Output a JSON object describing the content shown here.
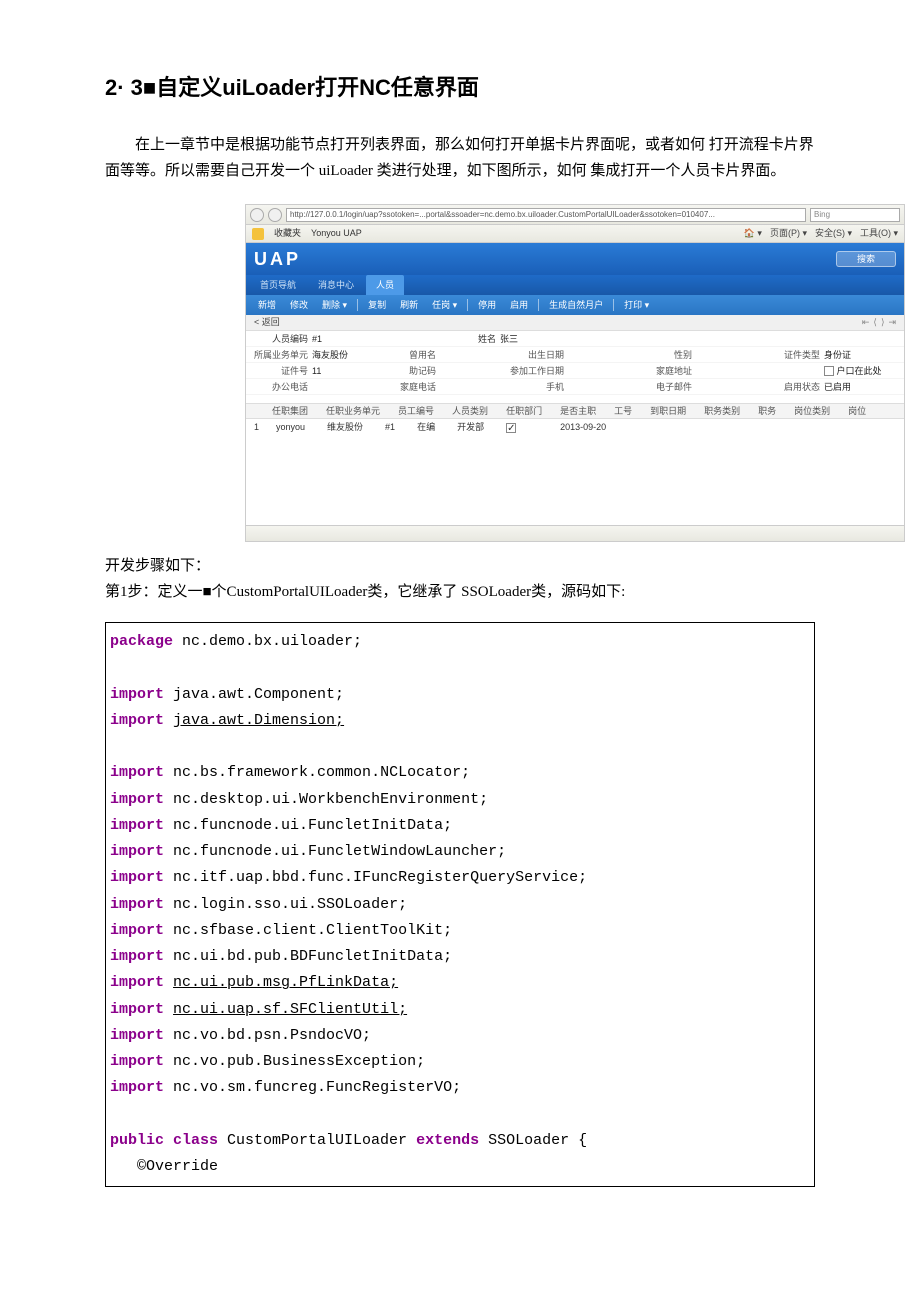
{
  "heading": "2· 3■自定义uiLoader打开NC任意界面",
  "intro": "在上一章节中是根据功能节点打开列表界面，那么如何打开单据卡片界面呢，或者如何 打开流程卡片界面等等。所以需要自己开发一个 uiLoader 类进行处理，如下图所示，如何 集成打开一个人员卡片界面。",
  "steps_intro": "开发步骤如下：",
  "step1": "第1步：定义一■个CustomPortalUILoader类，它继承了 SSOLoader类，源码如下:",
  "screenshot": {
    "browser": {
      "url": "http://127.0.0.1/login/uap?ssotoken=...portal&ssoader=nc.demo.bx.uiloader.CustomPortalUILoader&ssotoken=010407...",
      "search_placeholder": "Bing",
      "fav_label": "收藏夹",
      "fav_item": "Yonyou UAP",
      "fav_menu": [
        "页面(P) ▾",
        "安全(S) ▾",
        "工具(O) ▾"
      ]
    },
    "uap": {
      "logo": "UAP",
      "search_btn": "搜索",
      "tabs": [
        "首页导航",
        "消息中心",
        "人员"
      ],
      "toolbar": [
        "新增",
        "修改",
        "删除 ▾",
        "复制",
        "刷新",
        "任岗 ▾",
        "停用",
        "启用",
        "生成自然月户",
        "打印 ▾"
      ]
    },
    "back_label": "< 返回",
    "pager": [
      "⇤",
      "⟨",
      "⟩",
      "⇥"
    ],
    "form": {
      "row0": {
        "lbl1": "人员编码",
        "val1": "#1",
        "lbl2": "姓名",
        "val2": "张三"
      },
      "row1": {
        "lbl1": "所属业务单元",
        "val1": "海友股份",
        "lbl2": "曾用名",
        "lbl3": "出生日期",
        "lbl4": "性别",
        "lbl5": "证件类型",
        "val5": "身份证"
      },
      "row2": {
        "lbl1": "证件号",
        "val1": "11",
        "lbl2": "助记码",
        "lbl3": "参加工作日期",
        "lbl4": "家庭地址",
        "lbl6": "户口在此处"
      },
      "row3": {
        "lbl1": "办公电话",
        "lbl2": "家庭电话",
        "lbl3": "手机",
        "lbl4": "电子邮件",
        "lbl5": "启用状态",
        "val5": "已启用"
      }
    },
    "detail_headers": [
      "",
      "任职集团",
      "任职业务单元",
      "员工编号",
      "人员类别",
      "任职部门",
      "是否主职",
      "工号",
      "到职日期",
      "职务类别",
      "职务",
      "岗位类别",
      "岗位"
    ],
    "detail_values": [
      "1",
      "yonyou",
      "维友股份",
      "#1",
      "在编",
      "开发部",
      "☑",
      "",
      "2013-09-20",
      "",
      "",
      "",
      ""
    ]
  },
  "code": {
    "package": "nc.demo.bx.uiloader;",
    "imports": [
      {
        "text": "java.awt.Component;",
        "underline": false
      },
      {
        "text": "java.awt.Dimension;",
        "underline": true
      },
      {
        "text": "",
        "underline": false
      },
      {
        "text": "nc.bs.framework.common.NCLocator;",
        "underline": false
      },
      {
        "text": "nc.desktop.ui.WorkbenchEnvironment;",
        "underline": false
      },
      {
        "text": "nc.funcnode.ui.FuncletInitData;",
        "underline": false
      },
      {
        "text": "nc.funcnode.ui.FuncletWindowLauncher;",
        "underline": false
      },
      {
        "text": "nc.itf.uap.bbd.func.IFuncRegisterQueryService;",
        "underline": false
      },
      {
        "text": "nc.login.sso.ui.SSOLoader;",
        "underline": false
      },
      {
        "text": "nc.sfbase.client.ClientToolKit;",
        "underline": false
      },
      {
        "text": "nc.ui.bd.pub.BDFuncletInitData;",
        "underline": false
      },
      {
        "text": "nc.ui.pub.msg.PfLinkData;",
        "underline": true
      },
      {
        "text": "nc.ui.uap.sf.SFClientUtil;",
        "underline": true
      },
      {
        "text": "nc.vo.bd.psn.PsndocVO;",
        "underline": false
      },
      {
        "text": "nc.vo.pub.BusinessException;",
        "underline": false
      },
      {
        "text": "nc.vo.sm.funcreg.FuncRegisterVO;",
        "underline": false
      }
    ],
    "class_decl_pre": "public class ",
    "class_name": "CustomPortalUILoader ",
    "class_decl_mid": "extends ",
    "class_extends": "SSOLoader {",
    "override": "   ©Override"
  }
}
